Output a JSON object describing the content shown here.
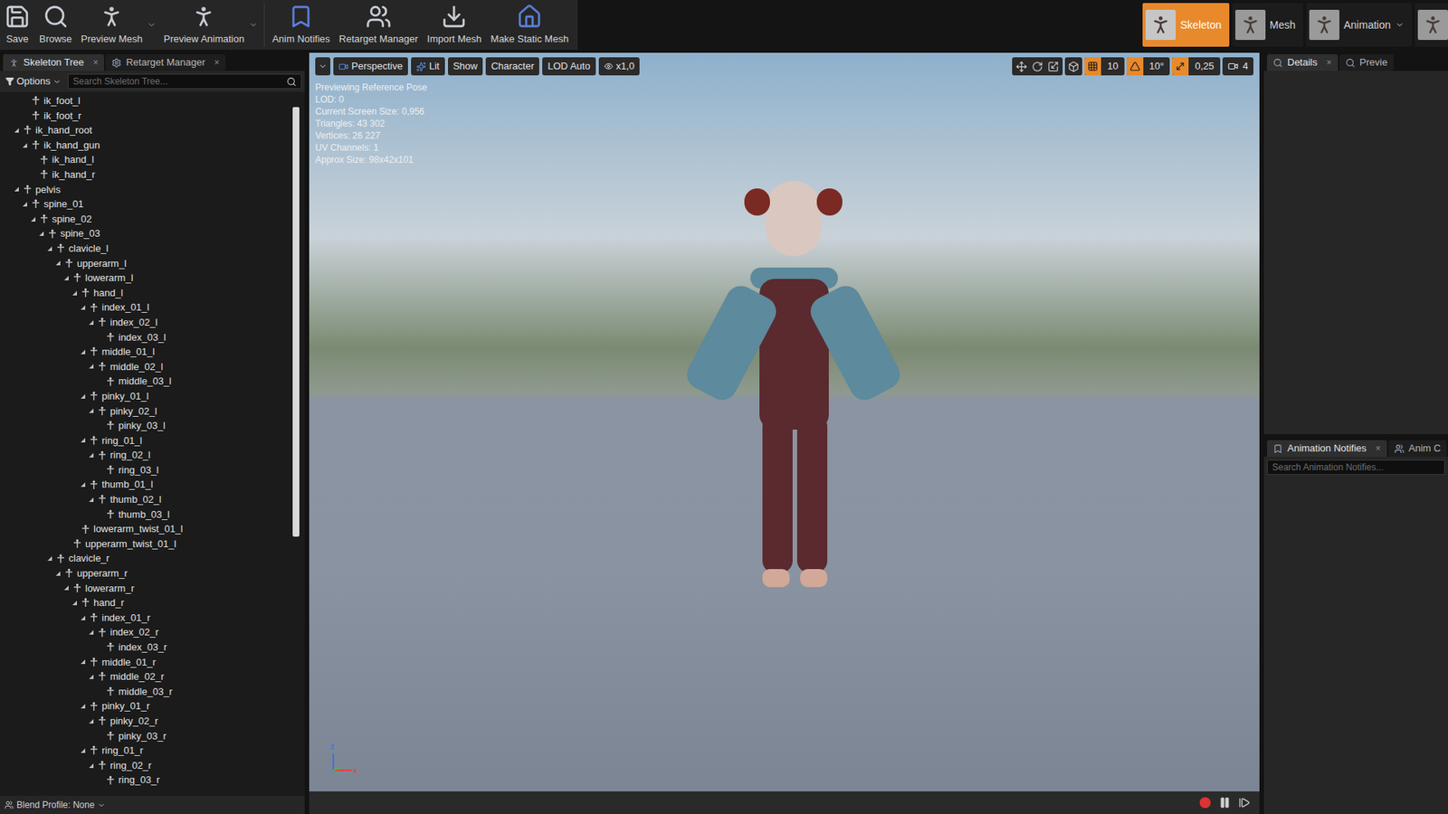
{
  "toolbar": [
    {
      "label": "Save",
      "dropdown": false
    },
    {
      "label": "Browse",
      "dropdown": false
    },
    {
      "label": "Preview Mesh",
      "dropdown": true
    },
    {
      "label": "Preview Animation",
      "dropdown": true
    },
    {
      "label": "Anim Notifies",
      "dropdown": false
    },
    {
      "label": "Retarget Manager",
      "dropdown": false
    },
    {
      "label": "Import Mesh",
      "dropdown": false
    },
    {
      "label": "Make Static Mesh",
      "dropdown": false
    }
  ],
  "modes": [
    {
      "label": "Skeleton",
      "selected": true,
      "dropdown": false
    },
    {
      "label": "Mesh",
      "selected": false,
      "dropdown": false
    },
    {
      "label": "Animation",
      "selected": false,
      "dropdown": true
    }
  ],
  "left_tabs": [
    {
      "label": "Skeleton Tree",
      "selected": true,
      "close": "×"
    },
    {
      "label": "Retarget Manager",
      "selected": false,
      "close": "×"
    }
  ],
  "tree_options": "Options",
  "tree_search": {
    "placeholder": "Search Skeleton Tree..."
  },
  "tree": [
    {
      "name": "ik_foot_l",
      "depth": 1,
      "has_children": false,
      "expanded": false
    },
    {
      "name": "ik_foot_r",
      "depth": 1,
      "has_children": false,
      "expanded": false
    },
    {
      "name": "ik_hand_root",
      "depth": 0,
      "has_children": true,
      "expanded": true
    },
    {
      "name": "ik_hand_gun",
      "depth": 1,
      "has_children": true,
      "expanded": true
    },
    {
      "name": "ik_hand_l",
      "depth": 2,
      "has_children": false,
      "expanded": false
    },
    {
      "name": "ik_hand_r",
      "depth": 2,
      "has_children": false,
      "expanded": false
    },
    {
      "name": "pelvis",
      "depth": 0,
      "has_children": true,
      "expanded": true
    },
    {
      "name": "spine_01",
      "depth": 1,
      "has_children": true,
      "expanded": true
    },
    {
      "name": "spine_02",
      "depth": 2,
      "has_children": true,
      "expanded": true
    },
    {
      "name": "spine_03",
      "depth": 3,
      "has_children": true,
      "expanded": true
    },
    {
      "name": "clavicle_l",
      "depth": 4,
      "has_children": true,
      "expanded": true
    },
    {
      "name": "upperarm_l",
      "depth": 5,
      "has_children": true,
      "expanded": true
    },
    {
      "name": "lowerarm_l",
      "depth": 6,
      "has_children": true,
      "expanded": true
    },
    {
      "name": "hand_l",
      "depth": 7,
      "has_children": true,
      "expanded": true
    },
    {
      "name": "index_01_l",
      "depth": 8,
      "has_children": true,
      "expanded": true
    },
    {
      "name": "index_02_l",
      "depth": 9,
      "has_children": true,
      "expanded": true
    },
    {
      "name": "index_03_l",
      "depth": 10,
      "has_children": false,
      "expanded": false
    },
    {
      "name": "middle_01_l",
      "depth": 8,
      "has_children": true,
      "expanded": true
    },
    {
      "name": "middle_02_l",
      "depth": 9,
      "has_children": true,
      "expanded": true
    },
    {
      "name": "middle_03_l",
      "depth": 10,
      "has_children": false,
      "expanded": false
    },
    {
      "name": "pinky_01_l",
      "depth": 8,
      "has_children": true,
      "expanded": true
    },
    {
      "name": "pinky_02_l",
      "depth": 9,
      "has_children": true,
      "expanded": true
    },
    {
      "name": "pinky_03_l",
      "depth": 10,
      "has_children": false,
      "expanded": false
    },
    {
      "name": "ring_01_l",
      "depth": 8,
      "has_children": true,
      "expanded": true
    },
    {
      "name": "ring_02_l",
      "depth": 9,
      "has_children": true,
      "expanded": true
    },
    {
      "name": "ring_03_l",
      "depth": 10,
      "has_children": false,
      "expanded": false
    },
    {
      "name": "thumb_01_l",
      "depth": 8,
      "has_children": true,
      "expanded": true
    },
    {
      "name": "thumb_02_l",
      "depth": 9,
      "has_children": true,
      "expanded": true
    },
    {
      "name": "thumb_03_l",
      "depth": 10,
      "has_children": false,
      "expanded": false
    },
    {
      "name": "lowerarm_twist_01_l",
      "depth": 7,
      "has_children": false,
      "expanded": false
    },
    {
      "name": "upperarm_twist_01_l",
      "depth": 6,
      "has_children": false,
      "expanded": false
    },
    {
      "name": "clavicle_r",
      "depth": 4,
      "has_children": true,
      "expanded": true
    },
    {
      "name": "upperarm_r",
      "depth": 5,
      "has_children": true,
      "expanded": true
    },
    {
      "name": "lowerarm_r",
      "depth": 6,
      "has_children": true,
      "expanded": true
    },
    {
      "name": "hand_r",
      "depth": 7,
      "has_children": true,
      "expanded": true
    },
    {
      "name": "index_01_r",
      "depth": 8,
      "has_children": true,
      "expanded": true
    },
    {
      "name": "index_02_r",
      "depth": 9,
      "has_children": true,
      "expanded": true
    },
    {
      "name": "index_03_r",
      "depth": 10,
      "has_children": false,
      "expanded": false
    },
    {
      "name": "middle_01_r",
      "depth": 8,
      "has_children": true,
      "expanded": true
    },
    {
      "name": "middle_02_r",
      "depth": 9,
      "has_children": true,
      "expanded": true
    },
    {
      "name": "middle_03_r",
      "depth": 10,
      "has_children": false,
      "expanded": false
    },
    {
      "name": "pinky_01_r",
      "depth": 8,
      "has_children": true,
      "expanded": true
    },
    {
      "name": "pinky_02_r",
      "depth": 9,
      "has_children": true,
      "expanded": true
    },
    {
      "name": "pinky_03_r",
      "depth": 10,
      "has_children": false,
      "expanded": false
    },
    {
      "name": "ring_01_r",
      "depth": 8,
      "has_children": true,
      "expanded": true
    },
    {
      "name": "ring_02_r",
      "depth": 9,
      "has_children": true,
      "expanded": true
    },
    {
      "name": "ring_03_r",
      "depth": 10,
      "has_children": false,
      "expanded": false
    }
  ],
  "blend_profile": "Blend Profile: None",
  "viewport": {
    "toolbar_left": [
      {
        "label": "Perspective",
        "kind": "camera"
      },
      {
        "label": "Lit",
        "kind": "lit"
      },
      {
        "label": "Show",
        "kind": "plain"
      },
      {
        "label": "Character",
        "kind": "plain"
      },
      {
        "label": "LOD Auto",
        "kind": "plain"
      },
      {
        "label": "x1,0",
        "kind": "speed"
      }
    ],
    "snaps": [
      {
        "value": "10",
        "on": true
      },
      {
        "value": "10°",
        "on": true
      },
      {
        "value": "0,25",
        "on": true
      }
    ],
    "camera_speed": "4",
    "stats": [
      "Previewing Reference Pose",
      "LOD: 0",
      "Current Screen Size: 0,956",
      "Triangles: 43 302",
      "Vertices: 26 227",
      "UV Channels: 1",
      "Approx Size: 98x42x101"
    ],
    "axes": [
      "z",
      "x"
    ]
  },
  "right_tabs": [
    {
      "label": "Details",
      "selected": true,
      "close": "×"
    },
    {
      "label": "Previe",
      "selected": false,
      "close": ""
    }
  ],
  "notify_tabs": [
    {
      "label": "Animation Notifies",
      "selected": true,
      "close": "×"
    },
    {
      "label": "Anim C",
      "selected": false,
      "close": ""
    }
  ],
  "notify_search": {
    "placeholder": "Search Animation Notifies..."
  }
}
